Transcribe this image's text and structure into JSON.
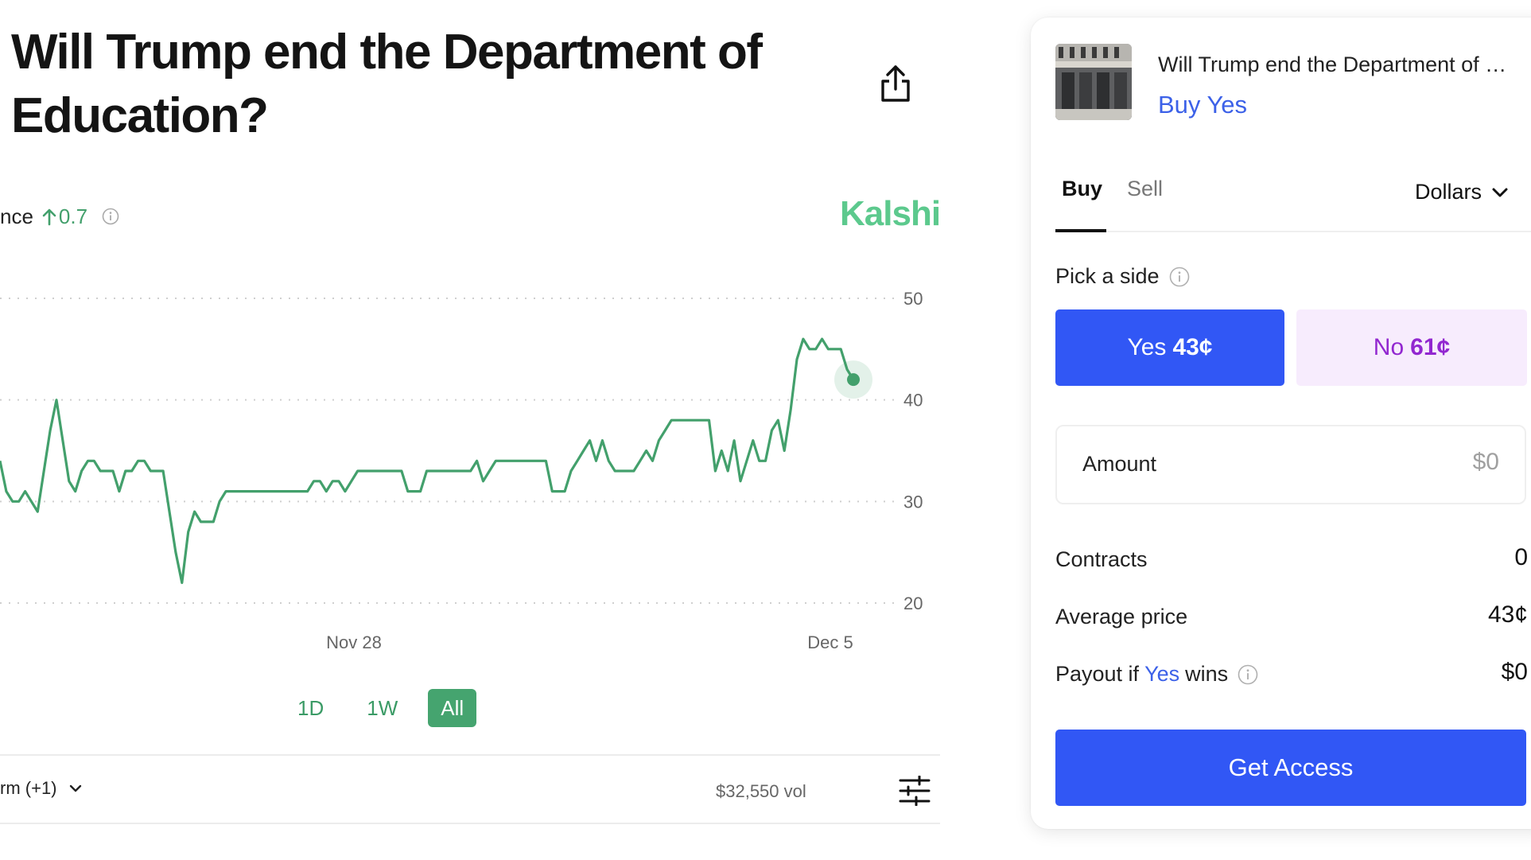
{
  "market": {
    "title": "Will Trump end the Department of Education?"
  },
  "chance": {
    "label": "nce",
    "delta": "0.7"
  },
  "brand": {
    "name": "Kalshi",
    "color": "#5cc98d"
  },
  "chart_data": {
    "type": "line",
    "x_ticks": [
      "Nov 28",
      "Dec 5"
    ],
    "y_ticks": [
      20,
      30,
      40,
      50
    ],
    "ylim": [
      20,
      50
    ],
    "grid": true,
    "series": [
      {
        "color": "#43a06c",
        "values": [
          34,
          31,
          30,
          30,
          31,
          30,
          29,
          33,
          37,
          40,
          36,
          32,
          31,
          33,
          34,
          34,
          33,
          33,
          33,
          31,
          33,
          33,
          34,
          34,
          33,
          33,
          33,
          29,
          25,
          22,
          27,
          29,
          28,
          28,
          28,
          30,
          31,
          31,
          31,
          31,
          31,
          31,
          31,
          31,
          31,
          31,
          31,
          31,
          31,
          31,
          32,
          32,
          31,
          32,
          32,
          31,
          32,
          33,
          33,
          33,
          33,
          33,
          33,
          33,
          33,
          31,
          31,
          31,
          33,
          33,
          33,
          33,
          33,
          33,
          33,
          33,
          34,
          32,
          33,
          34,
          34,
          34,
          34,
          34,
          34,
          34,
          34,
          34,
          31,
          31,
          31,
          33,
          34,
          35,
          36,
          34,
          36,
          34,
          33,
          33,
          33,
          33,
          34,
          35,
          34,
          36,
          37,
          38,
          38,
          38,
          38,
          38,
          38,
          38,
          33,
          35,
          33,
          36,
          32,
          34,
          36,
          34,
          34,
          37,
          38,
          35,
          39,
          44,
          46,
          45,
          45,
          46,
          45,
          45,
          45,
          43,
          42
        ]
      }
    ]
  },
  "range_tabs": [
    "1D",
    "1W",
    "All"
  ],
  "active_range": "All",
  "footer": {
    "market_select": "rm (+1)",
    "volume": "$32,550 vol"
  },
  "panel": {
    "market_name": "Will Trump end the Department of Education?",
    "action_label": "Buy Yes",
    "tabs": {
      "buy": "Buy",
      "sell": "Sell"
    },
    "currency": "Dollars",
    "pick_side_label": "Pick a side",
    "yes_button": {
      "label": "Yes",
      "price": "43¢"
    },
    "no_button": {
      "label": "No",
      "price": "61¢"
    },
    "amount": {
      "label": "Amount",
      "placeholder": "$0"
    },
    "contracts": {
      "label": "Contracts",
      "value": "0"
    },
    "average_price": {
      "label": "Average price",
      "value": "43¢"
    },
    "payout": {
      "prefix": "Payout if",
      "side": "Yes",
      "suffix": "wins",
      "value": "$0"
    },
    "cta": "Get Access"
  },
  "colors": {
    "accent_blue": "#3157f5",
    "chart_green": "#43a06c",
    "no_purple": "#9227d0"
  }
}
